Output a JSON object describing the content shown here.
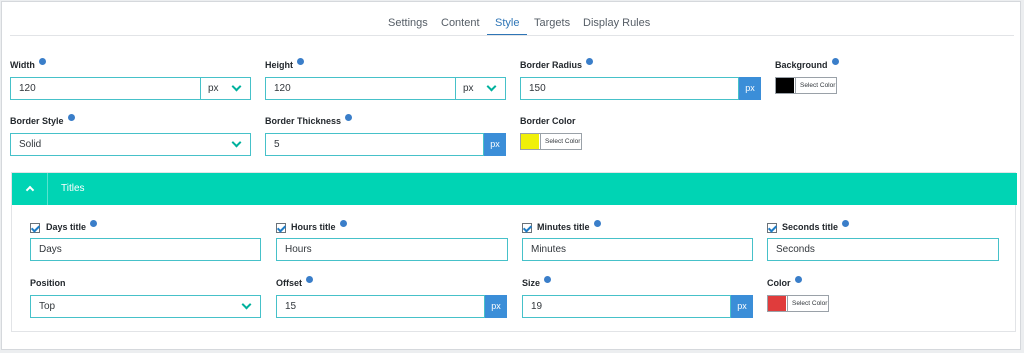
{
  "tabs": [
    {
      "label": "Settings",
      "active": false
    },
    {
      "label": "Content",
      "active": false
    },
    {
      "label": "Style",
      "active": true
    },
    {
      "label": "Targets",
      "active": false
    },
    {
      "label": "Display Rules",
      "active": false
    }
  ],
  "style": {
    "width": {
      "label": "Width",
      "value": "120",
      "unit": "px"
    },
    "height": {
      "label": "Height",
      "value": "120",
      "unit": "px"
    },
    "border_radius": {
      "label": "Border Radius",
      "value": "150",
      "unit": "px"
    },
    "background": {
      "label": "Background",
      "button": "Select Color",
      "color": "#000000"
    },
    "border_style": {
      "label": "Border Style",
      "value": "Solid"
    },
    "border_thickness": {
      "label": "Border Thickness",
      "value": "5",
      "unit": "px"
    },
    "border_color": {
      "label": "Border Color",
      "button": "Select Color",
      "color": "#f0f00a"
    }
  },
  "titles_panel": {
    "title": "Titles",
    "accent_color": "#00d4b4",
    "days": {
      "label": "Days title",
      "checked": true,
      "value": "Days"
    },
    "hours": {
      "label": "Hours title",
      "checked": true,
      "value": "Hours"
    },
    "minutes": {
      "label": "Minutes title",
      "checked": true,
      "value": "Minutes"
    },
    "seconds": {
      "label": "Seconds title",
      "checked": true,
      "value": "Seconds"
    },
    "position": {
      "label": "Position",
      "value": "Top"
    },
    "offset": {
      "label": "Offset",
      "value": "15",
      "unit": "px"
    },
    "size": {
      "label": "Size",
      "value": "19",
      "unit": "px"
    },
    "color": {
      "label": "Color",
      "button": "Select Color",
      "color": "#e03c3c"
    }
  }
}
